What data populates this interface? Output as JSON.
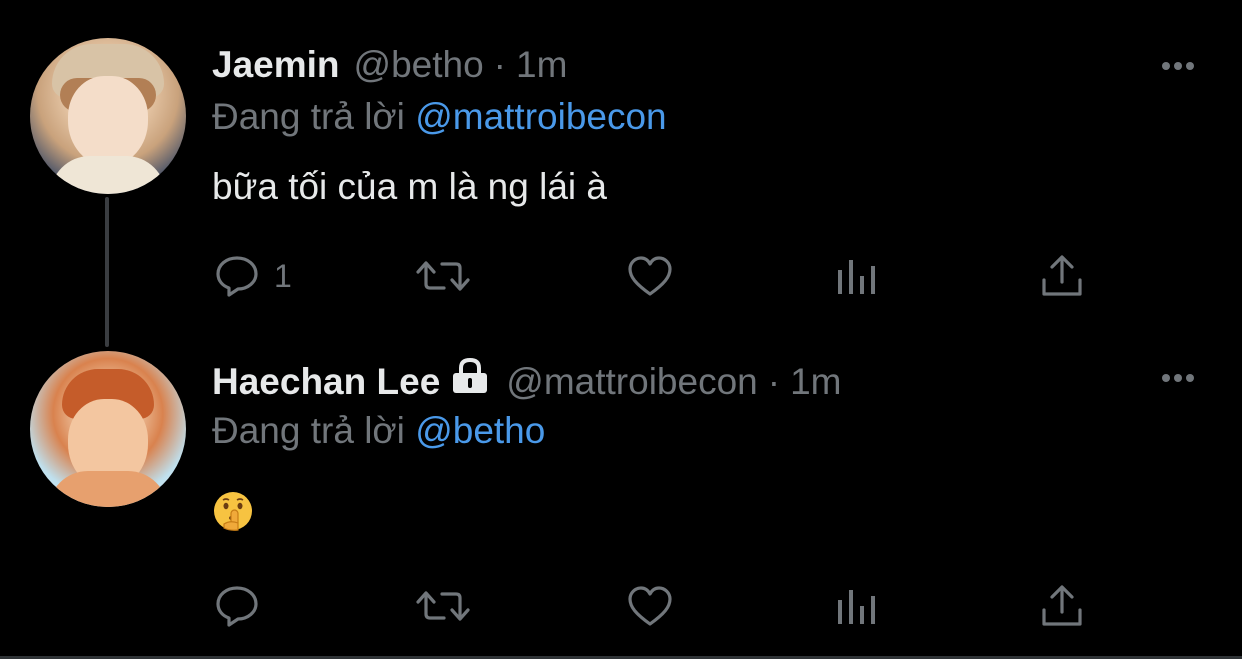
{
  "tweets": [
    {
      "display_name": "Jaemin",
      "handle": "@betho",
      "separator": "·",
      "time": "1m",
      "reply_prefix": "Đang trả lời",
      "reply_to": "@mattroibecon",
      "text": "bữa tối của m là ng lái à",
      "reply_count": "1",
      "locked": false
    },
    {
      "display_name": "Haechan Lee",
      "handle": "@mattroibecon",
      "separator": "·",
      "time": "1m",
      "reply_prefix": "Đang trả lời",
      "reply_to": "@betho",
      "text": "",
      "emoji": "shushing-face",
      "reply_count": "",
      "locked": true
    }
  ],
  "icons": {
    "reply": "reply-icon",
    "retweet": "retweet-icon",
    "like": "heart-icon",
    "analytics": "analytics-icon",
    "share": "share-icon",
    "more": "more-icon",
    "lock": "lock-icon"
  },
  "colors": {
    "background": "#000000",
    "primary_text": "#e7e9ea",
    "secondary_text": "#71767b",
    "mention": "#4a99e9",
    "connector": "#3a3d41"
  }
}
